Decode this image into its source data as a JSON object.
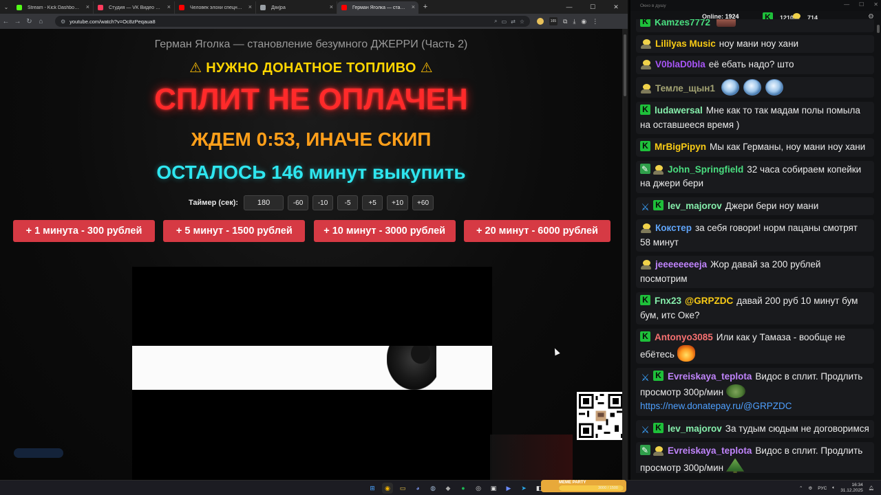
{
  "browser": {
    "tabs": [
      {
        "title": "Stream - Kick Dashboard",
        "color": "#53fc18"
      },
      {
        "title": "Студия — VK Видео Live",
        "color": "#ff3b5c"
      },
      {
        "title": "Человек элохи спецназа. Как",
        "color": "#ff0000"
      },
      {
        "title": "Дім]ра",
        "color": "#9aa0a6"
      },
      {
        "title": "Герман Яголка — становлени",
        "color": "#ff0000"
      }
    ],
    "url": "youtube.com/watch?v=Oc8zPeqaua8",
    "extension_badge": "165"
  },
  "page": {
    "video_title": "Герман Яголка — становление безумного ДЖЕРРИ (Часть 2)",
    "warning": "НУЖНО ДОНАТНОЕ ТОПЛИВО",
    "split_status": "СПЛИТ НЕ ОПЛАЧЕН",
    "wait_text": "ЖДЕМ 0:53, ИНАЧЕ СКИП",
    "remaining_text": "ОСТАЛОСЬ 146 минут выкупить",
    "timer": {
      "label": "Таймер (сек):",
      "value": "180",
      "steps": [
        "-60",
        "-10",
        "-5",
        "+5",
        "+10",
        "+60"
      ]
    },
    "donate_buttons": [
      "+ 1 минута - 300 рублей",
      "+ 5 минут - 1500 рублей",
      "+ 10 минут - 3000 рублей",
      "+ 20 минут - 6000 рублей"
    ],
    "accent_red": "#d63a44"
  },
  "chat": {
    "window_title": "Окно в душу",
    "online_label": "Online:",
    "online_count": "1924",
    "kick_count": "1210",
    "other_count": "714",
    "messages": [
      {
        "user": "Kamzes7772",
        "color": "#4ade80",
        "badges": [
          "kick"
        ],
        "text": "",
        "emotes": [
          "face"
        ]
      },
      {
        "user": "Lililyas Music",
        "color": "#facc15",
        "badges": [
          "yt"
        ],
        "text": "ноу мани ноу хани"
      },
      {
        "user": "V0blaD0bla",
        "color": "#a855f7",
        "badges": [
          "yt"
        ],
        "text": "её ебать надо? што"
      },
      {
        "user": "Темле_щын1",
        "color": "#a3a373",
        "badges": [
          "yt"
        ],
        "text": "",
        "emotes": [
          "ball",
          "ball",
          "ball"
        ]
      },
      {
        "user": "ludawersal",
        "color": "#86efac",
        "badges": [
          "kick"
        ],
        "text": "Мне как то так мадам полы помыла на оставшееся время )"
      },
      {
        "user": "MrBigPipyn",
        "color": "#facc15",
        "badges": [
          "kick"
        ],
        "text": "Мы как Германы, ноу мани ноу хани"
      },
      {
        "user": "John_Springfield",
        "color": "#4ade80",
        "badges": [
          "pen",
          "yt"
        ],
        "text": "32 часа собираем копейки на джери бери"
      },
      {
        "user": "lev_majorov",
        "color": "#86efac",
        "badges": [
          "sword",
          "kick"
        ],
        "text": "Джери бери ноу мани"
      },
      {
        "user": "Кокстер",
        "color": "#60a5fa",
        "badges": [
          "yt"
        ],
        "text": "за себя говори! норм пацаны смотрят 58 минут"
      },
      {
        "user": "jeeeeeeeeja",
        "color": "#c084fc",
        "badges": [
          "yt"
        ],
        "text": "Жор давай за 200 рублей посмотрим"
      },
      {
        "user": "Fnx23",
        "color": "#86efac",
        "badges": [
          "kick"
        ],
        "mention": "@GRPZDC",
        "text": "давай 200 руб 10 минут бум бум, итс Оке?"
      },
      {
        "user": "Antonyo3085",
        "color": "#f87171",
        "badges": [
          "kick"
        ],
        "text": "Или как у Тамаза - вообще не ебётесь",
        "emotes": [
          "fire"
        ]
      },
      {
        "user": "Evreiskaya_teplota",
        "color": "#c084fc",
        "badges": [
          "sword",
          "kick"
        ],
        "text": "Видос в сплит. Продлить просмотр 300р/мин",
        "emotes": [
          "frog"
        ],
        "link": "https://new.donatepay.ru/@GRPZDC"
      },
      {
        "user": "lev_majorov",
        "color": "#86efac",
        "badges": [
          "sword",
          "kick"
        ],
        "text": "За тудым сюдым не договоримся"
      },
      {
        "user": "Evreiskaya_teplota",
        "color": "#c084fc",
        "badges": [
          "pen",
          "yt"
        ],
        "text": "Видос в сплит. Продлить просмотр 300р/мин",
        "emotes": [
          "tree"
        ],
        "link": "https://new.donatepay.ru/@GRPZDC"
      }
    ]
  },
  "taskbar": {
    "widget_title": "MEME PARTY",
    "widget_progress": "3000 / 1500",
    "widget_fill_fraction": 1.0,
    "lang": "РУС",
    "time": "16:34",
    "date": "31.12.2025"
  }
}
